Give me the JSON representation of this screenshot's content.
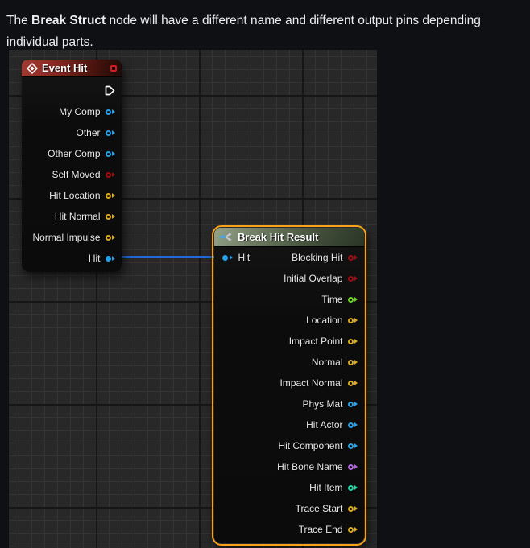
{
  "doc": {
    "paragraph": {
      "prefix": "The ",
      "bold": "Break Struct",
      "suffix": " node will have a different name and different output pins depending",
      "line2": "individual parts."
    }
  },
  "graph": {
    "event_node": {
      "title": "Event Hit",
      "pins": [
        {
          "kind": "exec",
          "label": ""
        },
        {
          "label": "My Comp",
          "color": "blue"
        },
        {
          "label": "Other",
          "color": "blue"
        },
        {
          "label": "Other Comp",
          "color": "blue"
        },
        {
          "label": "Self Moved",
          "color": "red"
        },
        {
          "label": "Hit Location",
          "color": "gold"
        },
        {
          "label": "Hit Normal",
          "color": "gold"
        },
        {
          "label": "Normal Impulse",
          "color": "gold"
        },
        {
          "label": "Hit",
          "color": "blue",
          "connected": true
        }
      ]
    },
    "break_node": {
      "title": "Break Hit Result",
      "input": {
        "label": "Hit",
        "color": "blue",
        "connected": true
      },
      "outputs": [
        {
          "label": "Blocking Hit",
          "color": "red"
        },
        {
          "label": "Initial Overlap",
          "color": "red"
        },
        {
          "label": "Time",
          "color": "green"
        },
        {
          "label": "Location",
          "color": "gold"
        },
        {
          "label": "Impact Point",
          "color": "gold"
        },
        {
          "label": "Normal",
          "color": "gold"
        },
        {
          "label": "Impact Normal",
          "color": "gold"
        },
        {
          "label": "Phys Mat",
          "color": "blue"
        },
        {
          "label": "Hit Actor",
          "color": "blue"
        },
        {
          "label": "Hit Component",
          "color": "blue"
        },
        {
          "label": "Hit Bone Name",
          "color": "purple"
        },
        {
          "label": "Hit Item",
          "color": "teal"
        },
        {
          "label": "Trace Start",
          "color": "gold"
        },
        {
          "label": "Trace End",
          "color": "gold"
        }
      ]
    }
  },
  "colors": {
    "page_bg": "#0e1014",
    "text": "#ededef",
    "graph_bg": "#282828",
    "grid_minor": "#343434",
    "grid_major": "#161616",
    "selection_outline": "#f7a21a",
    "wire": "#2268d8",
    "exec_pin": "#ffffff",
    "delegate_pin": "#d31c1c",
    "event_header_gradient": [
      "#a23a33",
      "#1e0a07"
    ],
    "break_header_gradient": [
      "#95a28a",
      "#2a3527"
    ],
    "pin": {
      "blue": "#27a0e8",
      "red": "#9e0e0e",
      "gold": "#dcaa1d",
      "green": "#6bd41f",
      "teal": "#1fd4a5",
      "purple": "#b163dd"
    }
  }
}
